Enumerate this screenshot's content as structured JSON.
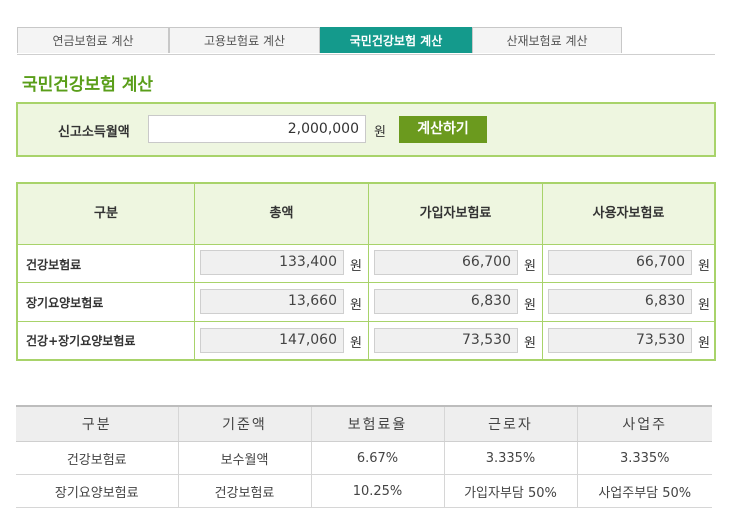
{
  "tabs": [
    {
      "label": "연금보험료 계산",
      "active": false
    },
    {
      "label": "고용보험료 계산",
      "active": false
    },
    {
      "label": "국민건강보험 계산",
      "active": true
    },
    {
      "label": "산재보험료 계산",
      "active": false
    }
  ],
  "title": "국민건강보험 계산",
  "input": {
    "label": "신고소득월액",
    "value": "2,000,000",
    "unit": "원",
    "button": "계산하기"
  },
  "result": {
    "headers": [
      "구분",
      "총액",
      "가입자보험료",
      "사용자보험료"
    ],
    "unit": "원",
    "rows": [
      {
        "label": "건강보험료",
        "total": "133,400",
        "employee": "66,700",
        "employer": "66,700"
      },
      {
        "label": "장기요양보험료",
        "total": "13,660",
        "employee": "6,830",
        "employer": "6,830"
      },
      {
        "label": "건강+장기요양보험료",
        "total": "147,060",
        "employee": "73,530",
        "employer": "73,530"
      }
    ]
  },
  "rates": {
    "headers": [
      "구분",
      "기준액",
      "보험료율",
      "근로자",
      "사업주"
    ],
    "rows": [
      [
        "건강보험료",
        "보수월액",
        "6.67%",
        "3.335%",
        "3.335%"
      ],
      [
        "장기요양보험료",
        "건강보험료",
        "10.25%",
        "가입자부담 50%",
        "사업주부담 50%"
      ]
    ]
  },
  "colors": {
    "active_tab": "#149a8c",
    "title_green": "#5a9e1a",
    "panel_bg": "#eef6e0",
    "panel_border": "#a8d36a",
    "button": "#6b9a1e"
  }
}
